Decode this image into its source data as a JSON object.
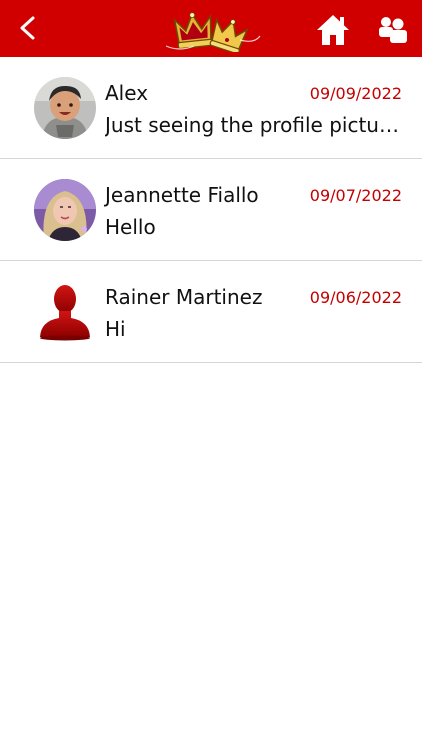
{
  "header": {
    "back_icon": "chevron-left-icon",
    "logo_icon": "crowns-logo",
    "home_icon": "home-icon",
    "people_icon": "people-icon",
    "bar_color": "#d00000"
  },
  "conversations": [
    {
      "name": "Alex",
      "date": "09/09/2022",
      "message": "Just seeing the profile picture...",
      "avatar": "photo-baby"
    },
    {
      "name": "Jeannette Fiallo",
      "date": "09/07/2022",
      "message": "Hello",
      "avatar": "photo-woman"
    },
    {
      "name": "Rainer Martinez",
      "date": "09/06/2022",
      "message": "Hi",
      "avatar": "default-user-silhouette"
    }
  ],
  "colors": {
    "accent": "#d00000",
    "date_text": "#c40000",
    "divider": "#d6d6d6"
  }
}
